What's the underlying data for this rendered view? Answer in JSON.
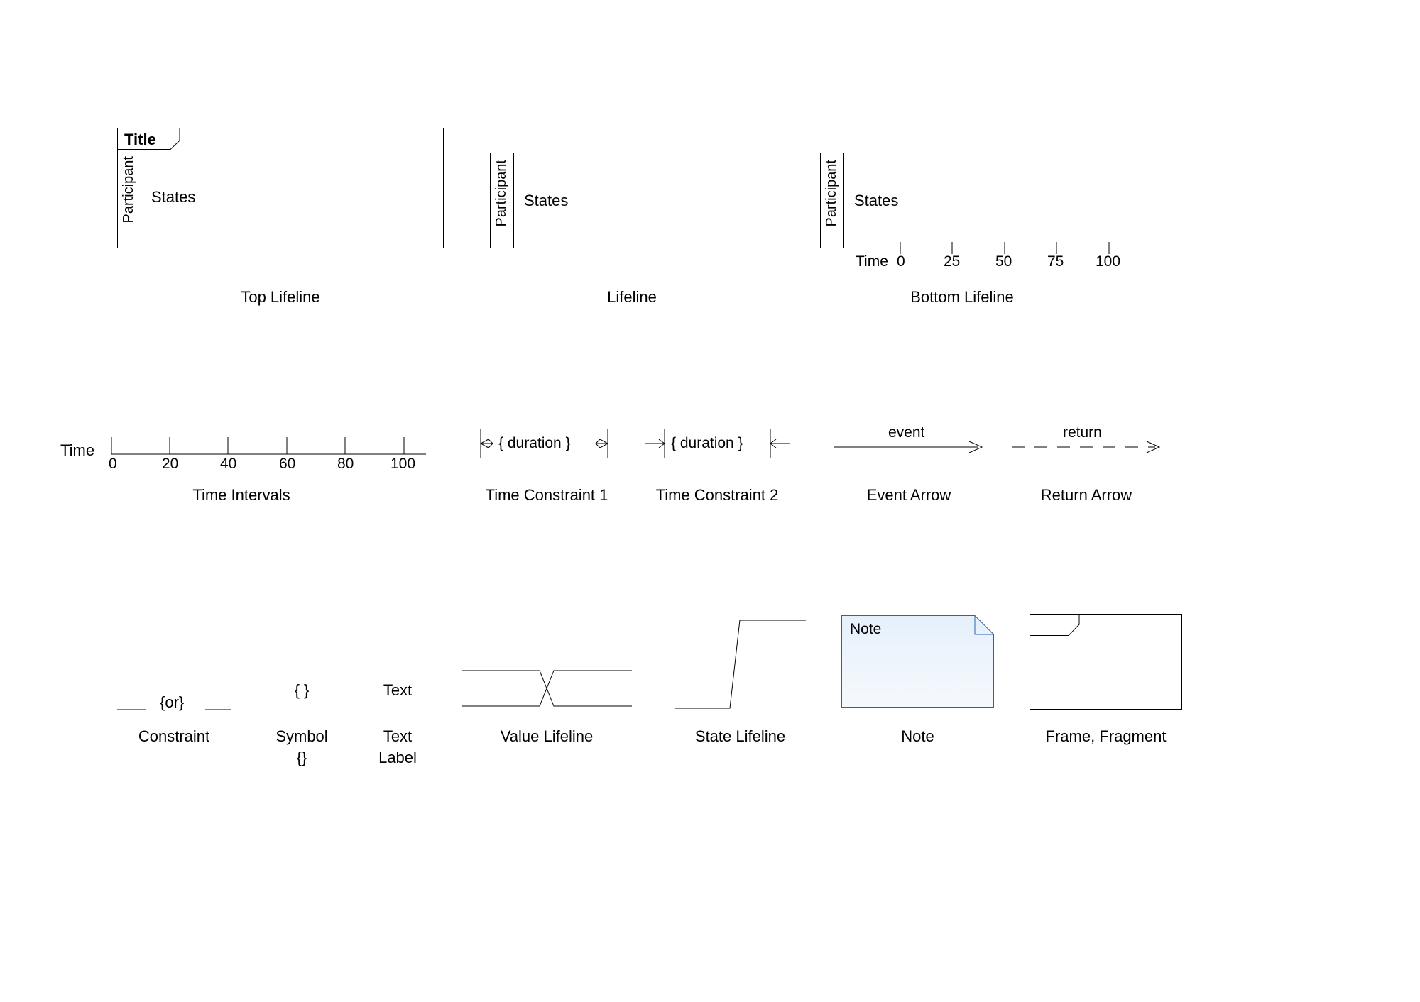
{
  "row1": {
    "top_lifeline": {
      "title": "Title",
      "participant": "Participant",
      "states": "States",
      "caption": "Top Lifeline"
    },
    "lifeline": {
      "participant": "Participant",
      "states": "States",
      "caption": "Lifeline"
    },
    "bottom_lifeline": {
      "participant": "Participant",
      "states": "States",
      "time_label": "Time",
      "ticks": [
        "0",
        "25",
        "50",
        "75",
        "100"
      ],
      "caption": "Bottom Lifeline"
    }
  },
  "row2": {
    "time_intervals": {
      "time_label": "Time",
      "ticks": [
        "0",
        "20",
        "40",
        "60",
        "80",
        "100"
      ],
      "caption": "Time Intervals"
    },
    "time_constraint1": {
      "label": "{ duration }",
      "caption": "Time Constraint 1"
    },
    "time_constraint2": {
      "label": "{ duration }",
      "caption": "Time Constraint 2"
    },
    "event_arrow": {
      "label": "event",
      "caption": "Event Arrow"
    },
    "return_arrow": {
      "label": "return",
      "caption": "Return Arrow"
    }
  },
  "row3": {
    "constraint": {
      "label": "{or}",
      "caption": "Constraint"
    },
    "symbol": {
      "label": "{ }",
      "caption_l1": "Symbol",
      "caption_l2": "{}"
    },
    "text_label": {
      "label": "Text",
      "caption_l1": "Text",
      "caption_l2": "Label"
    },
    "value_lifeline": {
      "caption": "Value Lifeline"
    },
    "state_lifeline": {
      "caption": "State Lifeline"
    },
    "note": {
      "label": "Note",
      "caption": "Note"
    },
    "frame": {
      "caption": "Frame, Fragment"
    }
  }
}
